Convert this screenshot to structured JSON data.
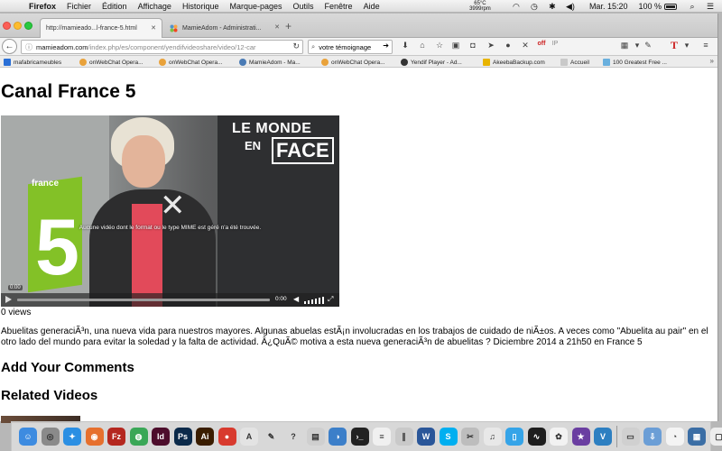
{
  "menubar": {
    "app": "Firefox",
    "items": [
      "Fichier",
      "Édition",
      "Affichage",
      "Historique",
      "Marque-pages",
      "Outils",
      "Fenêtre",
      "Aide"
    ],
    "cpu_temp": "65°C",
    "fan_rpm": "3999rpm",
    "clock": "Mar. 15:20",
    "battery": "100 %"
  },
  "tabs": [
    {
      "title": "http://mamieado...l-france-5.html",
      "active": true
    },
    {
      "title": "MamieAdom - Administrati...",
      "active": false
    }
  ],
  "navbar": {
    "url_host": "mamieadom.com",
    "url_path": "/index.php/es/component/yendifvideoshare/video/12-car",
    "search_value": "votre témoignage"
  },
  "toolbar": {
    "vpn_label": "off",
    "ip_label": "IP"
  },
  "bookmarks": [
    {
      "label": "mafabricameubles",
      "color": "#2a6fd6"
    },
    {
      "label": "onWebChat Opera...",
      "color": "#e9a23b"
    },
    {
      "label": "onWebChat Opera...",
      "color": "#e9a23b"
    },
    {
      "label": "MamieAdom - Ma...",
      "color": "#4a7bb5"
    },
    {
      "label": "onWebChat Opera...",
      "color": "#e9a23b"
    },
    {
      "label": "Yendif Player - Ad...",
      "color": "#333333"
    },
    {
      "label": "AkeebaBackup.com",
      "color": "#e8b400"
    },
    {
      "label": "Accueil",
      "color": "#c9c9c9"
    },
    {
      "label": "100 Greatest Free ...",
      "color": "#6ab0de"
    }
  ],
  "page": {
    "title": "Canal France 5",
    "views": "0 views",
    "description": "Abuelitas generaciÃ³n, una nueva vida para nuestros mayores. Algunas abuelas estÃ¡n involucradas en los trabajos de cuidado de niÃ±os. A veces como \"Abuelita au pair\" en el otro lado del mundo para evitar la soledad y la falta de actividad. Â¿QuÃ© motiva a esta nueva generaciÃ³n de abuelitas ? Diciembre 2014 a 21h50 en France 5",
    "comments_heading": "Add Your Comments",
    "related_heading": "Related Videos"
  },
  "video": {
    "message": "Aucune vidéo dont le format ou le type MIME est géré n'a été trouvée.",
    "overlay_line1": "LE MONDE",
    "overlay_line2": "EN",
    "overlay_line3": "FACE",
    "channel_text": "france",
    "channel_number": "5",
    "current_time": "0:00",
    "duration": "0:00",
    "progress": 0
  },
  "dock": [
    {
      "name": "finder",
      "color": "#3d8be0",
      "glyph": "☺"
    },
    {
      "name": "launchpad",
      "color": "#8a8a8a",
      "glyph": "◎"
    },
    {
      "name": "safari",
      "color": "#2b8fe3",
      "glyph": "✦"
    },
    {
      "name": "firefox",
      "color": "#e6702e",
      "glyph": "◉"
    },
    {
      "name": "filezilla",
      "color": "#b4271f",
      "glyph": "Fz"
    },
    {
      "name": "chrome",
      "color": "#3aa757",
      "glyph": "◍"
    },
    {
      "name": "indesign",
      "color": "#4d0d2c",
      "glyph": "Id"
    },
    {
      "name": "photoshop",
      "color": "#0b2a4a",
      "glyph": "Ps"
    },
    {
      "name": "illustrator",
      "color": "#3a1d00",
      "glyph": "Ai"
    },
    {
      "name": "app-red",
      "color": "#d83a2e",
      "glyph": "●"
    },
    {
      "name": "acrobat",
      "color": "#e3e3e3",
      "glyph": "A"
    },
    {
      "name": "script",
      "color": "#d8d8d8",
      "glyph": "✎"
    },
    {
      "name": "help",
      "color": "#d8d8d8",
      "glyph": "?"
    },
    {
      "name": "preview",
      "color": "#cfcfcf",
      "glyph": "▤"
    },
    {
      "name": "app-blue",
      "color": "#3c7fc9",
      "glyph": "◑"
    },
    {
      "name": "terminal",
      "color": "#222222",
      "glyph": "›_"
    },
    {
      "name": "textedit",
      "color": "#f0f0f0",
      "glyph": "≡"
    },
    {
      "name": "books",
      "color": "#c9c9c9",
      "glyph": "∥"
    },
    {
      "name": "word",
      "color": "#2a5699",
      "glyph": "W"
    },
    {
      "name": "skype",
      "color": "#00aff0",
      "glyph": "S"
    },
    {
      "name": "tools",
      "color": "#bdbdbd",
      "glyph": "✂"
    },
    {
      "name": "itunes",
      "color": "#e8e8e8",
      "glyph": "♫"
    },
    {
      "name": "mobile",
      "color": "#35a4e8",
      "glyph": "▯"
    },
    {
      "name": "activity",
      "color": "#1e1e1e",
      "glyph": "∿"
    },
    {
      "name": "photos",
      "color": "#f2f2f2",
      "glyph": "✿"
    },
    {
      "name": "imovie",
      "color": "#6a3ea1",
      "glyph": "★"
    },
    {
      "name": "vectorize",
      "color": "#2d7fc1",
      "glyph": "V"
    },
    {
      "name": "app-gray",
      "color": "#d0d0d0",
      "glyph": "▭"
    },
    {
      "name": "downloads",
      "color": "#6b9ed6",
      "glyph": "⇩"
    },
    {
      "name": "messages",
      "color": "#f4f4f4",
      "glyph": "◔"
    },
    {
      "name": "notes",
      "color": "#3b6ea5",
      "glyph": "▦"
    },
    {
      "name": "document",
      "color": "#ededed",
      "glyph": "▢"
    },
    {
      "name": "trash",
      "color": "#dadada",
      "glyph": "⌂"
    }
  ],
  "colors": {
    "francetv_green": "#83c127",
    "shirt_pink": "#e24a5a"
  }
}
